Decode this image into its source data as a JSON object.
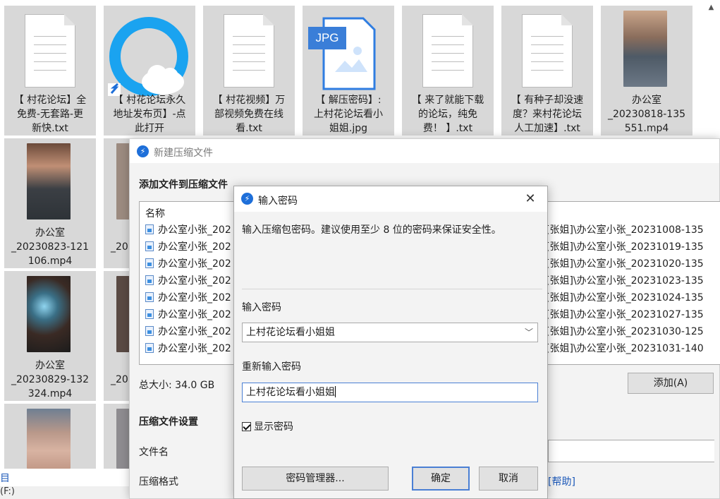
{
  "explorer": {
    "top_row": [
      {
        "caption": "【 村花论坛】全\n免费-无套路-更\n新快.txt",
        "icon": "text-file-icon"
      },
      {
        "caption": "【 村花论坛永久\n地址发布页】-点\n此打开",
        "icon": "browser-shortcut-icon"
      },
      {
        "caption": "【 村花视频】万\n部视频免费在线\n看.txt",
        "icon": "text-file-icon"
      },
      {
        "caption": "【 解压密码】:\n上村花论坛看小\n姐姐.jpg",
        "icon": "jpg-file-icon",
        "badge": "JPG"
      },
      {
        "caption": "【 来了就能下载\n的论坛，纯免\n费！ 】.txt",
        "icon": "text-file-icon"
      },
      {
        "caption": "【 有种子却没速\n度？来村花论坛\n人工加速】.txt",
        "icon": "text-file-icon"
      },
      {
        "caption": "办公室\n_20230818-135\n551.mp4",
        "icon": "video-thumbnail"
      }
    ],
    "left_column": [
      {
        "caption": "办公室\n_20230823-121\n106.mp4"
      },
      {
        "caption": "办公室\n_20230829-132\n324.mp4"
      },
      {
        "caption": ""
      }
    ],
    "second_column_fragments": [
      "_20",
      "_20"
    ],
    "selection_fragment": "目",
    "status_fragment": "(F:)"
  },
  "compress_dialog": {
    "title": "新建压缩文件",
    "section_add": "添加文件到压缩文件",
    "column_name": "名称",
    "files": [
      {
        "name": "办公室小张_202",
        "path": "[张姐]\\办公室小张_20231008-135"
      },
      {
        "name": "办公室小张_202",
        "path": "[张姐]\\办公室小张_20231019-135"
      },
      {
        "name": "办公室小张_202",
        "path": "[张姐]\\办公室小张_20231020-135"
      },
      {
        "name": "办公室小张_202",
        "path": "[张姐]\\办公室小张_20231023-135"
      },
      {
        "name": "办公室小张_202",
        "path": "[张姐]\\办公室小张_20231024-135"
      },
      {
        "name": "办公室小张_202",
        "path": "[张姐]\\办公室小张_20231027-135"
      },
      {
        "name": "办公室小张_202",
        "path": "[张姐]\\办公室小张_20231030-125"
      },
      {
        "name": "办公室小张_202",
        "path": "[张姐]\\办公室小张_20231031-140"
      }
    ],
    "total_size": "总大小: 34.0 GB",
    "add_button": "添加(A)",
    "section_settings": "压缩文件设置",
    "filename_label": "文件名",
    "format_label": "压缩格式",
    "help_link": "[帮助]"
  },
  "password_dialog": {
    "title": "输入密码",
    "hint": "输入压缩包密码。建议使用至少 8 位的密码来保证安全性。",
    "enter_label": "输入密码",
    "password_value": "上村花论坛看小姐姐",
    "reenter_label": "重新输入密码",
    "reenter_value": "上村花论坛看小姐姐",
    "show_password_label": "显示密码",
    "show_password_checked": true,
    "manager_button": "密码管理器...",
    "ok_button": "确定",
    "cancel_button": "取消"
  },
  "colors": {
    "accent": "#1e6fd9",
    "tile_bg": "#d8d8d8",
    "dialog_bg": "#f3f3f3",
    "link": "#1a57b8"
  }
}
